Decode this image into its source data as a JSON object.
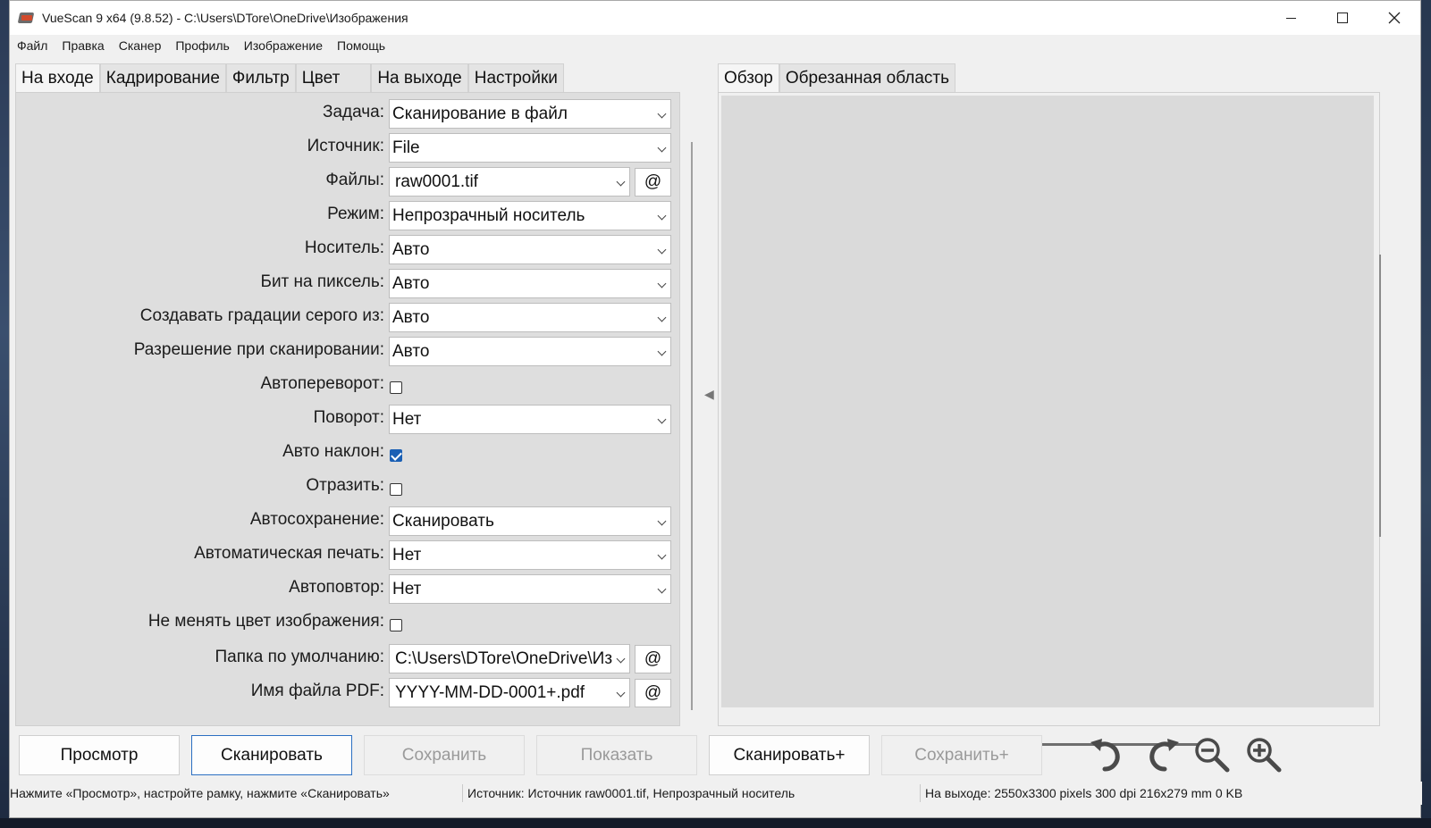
{
  "window": {
    "title": "VueScan 9 x64 (9.8.52) - C:\\Users\\DTore\\OneDrive\\Изображения"
  },
  "menu": [
    "Файл",
    "Правка",
    "Сканер",
    "Профиль",
    "Изображение",
    "Помощь"
  ],
  "left_tabs": [
    "На входе",
    "Кадрирование",
    "Фильтр",
    "Цвет",
    "На выходе",
    "Настройки"
  ],
  "active_left_tab": "На входе",
  "form": {
    "task": {
      "label": "Задача:",
      "value": "Сканирование в файл"
    },
    "source": {
      "label": "Источник:",
      "value": "File"
    },
    "files": {
      "label": "Файлы:",
      "value": "raw0001.tif",
      "button": "@"
    },
    "mode": {
      "label": "Режим:",
      "value": "Непрозрачный носитель"
    },
    "media": {
      "label": "Носитель:",
      "value": "Авто"
    },
    "bits": {
      "label": "Бит на пиксель:",
      "value": "Авто"
    },
    "gray_from": {
      "label": "Создавать градации серого из:",
      "value": "Авто"
    },
    "resolution": {
      "label": "Разрешение при сканировании:",
      "value": "Авто"
    },
    "auto_flip": {
      "label": "Автопереворот:",
      "checked": false
    },
    "rotation": {
      "label": "Поворот:",
      "value": "Нет"
    },
    "auto_skew": {
      "label": "Авто наклон:",
      "checked": true
    },
    "mirror": {
      "label": "Отразить:",
      "checked": false
    },
    "auto_save": {
      "label": "Автосохранение:",
      "value": "Сканировать"
    },
    "auto_print": {
      "label": "Автоматическая печать:",
      "value": "Нет"
    },
    "auto_repeat": {
      "label": "Автоповтор:",
      "value": "Нет"
    },
    "keep_color": {
      "label": "Не менять цвет изображения:",
      "checked": false
    },
    "default_folder": {
      "label": "Папка по умолчанию:",
      "value": "C:\\Users\\DTore\\OneDrive\\Из",
      "button": "@"
    },
    "pdf_name": {
      "label": "Имя файла PDF:",
      "value": "YYYY-MM-DD-0001+.pdf",
      "button": "@"
    }
  },
  "right_tabs": [
    "Обзор",
    "Обрезанная область"
  ],
  "active_right_tab": "Обзор",
  "buttons": {
    "preview": "Просмотр",
    "scan": "Сканировать",
    "save": "Сохранить",
    "show": "Показать",
    "scan_plus": "Сканировать+",
    "save_plus": "Сохранить+"
  },
  "tool_icons": [
    "rotate-left-icon",
    "rotate-right-icon",
    "zoom-out-icon",
    "zoom-in-icon"
  ],
  "status": {
    "hint": "Нажмите «Просмотр», настройте рамку, нажмите «Сканировать»",
    "source": "Источник: Источник raw0001.tif, Непрозрачный носитель",
    "output": "На выходе: 2550x3300 pixels 300 dpi 216x279 mm 0 KB"
  },
  "colors": {
    "accent": "#2b6fc2",
    "checkbox_checked": "#1a5fb4"
  }
}
